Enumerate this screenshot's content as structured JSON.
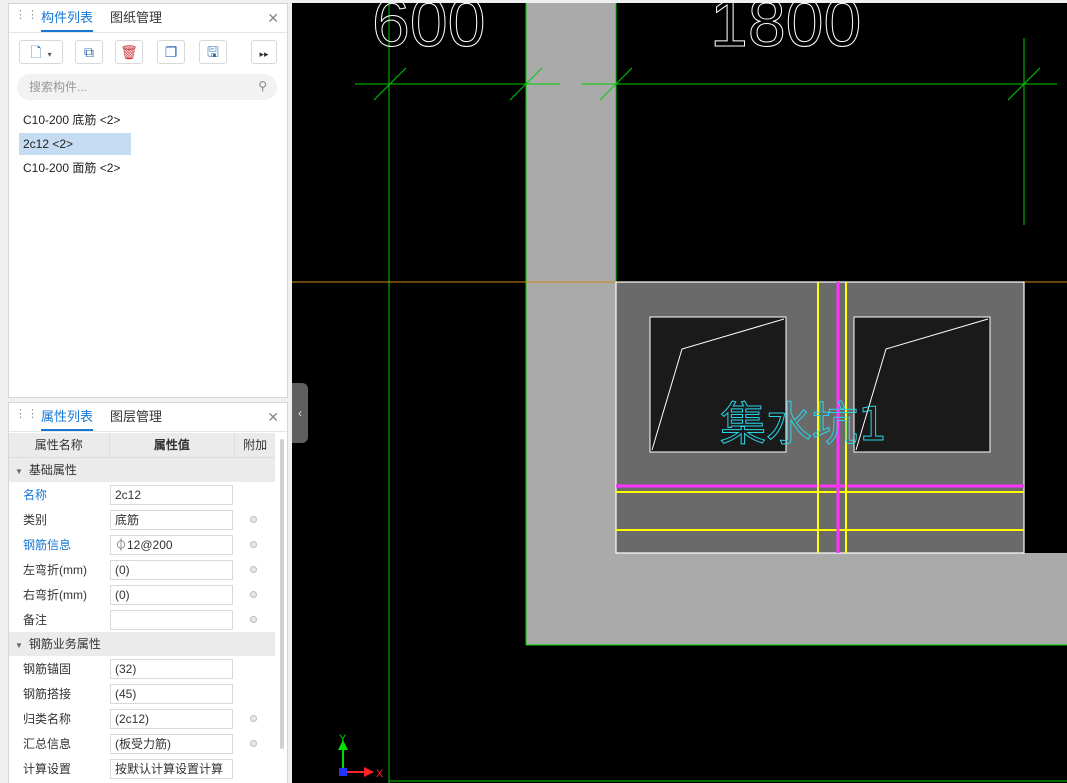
{
  "component_panel": {
    "tabs": [
      "构件列表",
      "图纸管理"
    ],
    "search_placeholder": "搜索构件...",
    "items": [
      {
        "label": "C10-200 底筋 <2>",
        "selected": false
      },
      {
        "label": "2c12 <2>",
        "selected": true
      },
      {
        "label": "C10-200 面筋 <2>",
        "selected": false
      }
    ]
  },
  "property_panel": {
    "tabs": [
      "属性列表",
      "图层管理"
    ],
    "columns": [
      "属性名称",
      "属性值",
      "附加"
    ],
    "groups": [
      {
        "title": "基础属性",
        "rows": [
          {
            "name": "名称",
            "value": "2c12",
            "blue": true,
            "dot": false
          },
          {
            "name": "类别",
            "value": "底筋",
            "blue": false,
            "dot": true
          },
          {
            "name": "钢筋信息",
            "value": "⏀12@200",
            "blue": true,
            "dot": true
          },
          {
            "name": "左弯折(mm)",
            "value": "(0)",
            "blue": false,
            "dot": true
          },
          {
            "name": "右弯折(mm)",
            "value": "(0)",
            "blue": false,
            "dot": true
          },
          {
            "name": "备注",
            "value": "",
            "blue": false,
            "dot": true
          }
        ]
      },
      {
        "title": "钢筋业务属性",
        "rows": [
          {
            "name": "钢筋锚固",
            "value": "(32)",
            "blue": false,
            "dot": false
          },
          {
            "name": "钢筋搭接",
            "value": "(45)",
            "blue": false,
            "dot": false
          },
          {
            "name": "归类名称",
            "value": "(2c12)",
            "blue": false,
            "dot": true
          },
          {
            "name": "汇总信息",
            "value": "(板受力筋)",
            "blue": false,
            "dot": true
          },
          {
            "name": "计算设置",
            "value": "按默认计算设置计算",
            "blue": false,
            "dot": false
          }
        ]
      }
    ]
  },
  "canvas": {
    "dimension_labels": [
      "600",
      "1800"
    ],
    "pit_label": "集水坑1",
    "axis_x": "X",
    "axis_y": "Y"
  },
  "colors": {
    "accent": "#1677d4",
    "grid_line": "#00cc00",
    "rebar_yellow": "#ffff00",
    "rebar_magenta": "#ff33ff",
    "pit_text": "#2ad4e8",
    "wall_gray": "#aaaaaa"
  }
}
